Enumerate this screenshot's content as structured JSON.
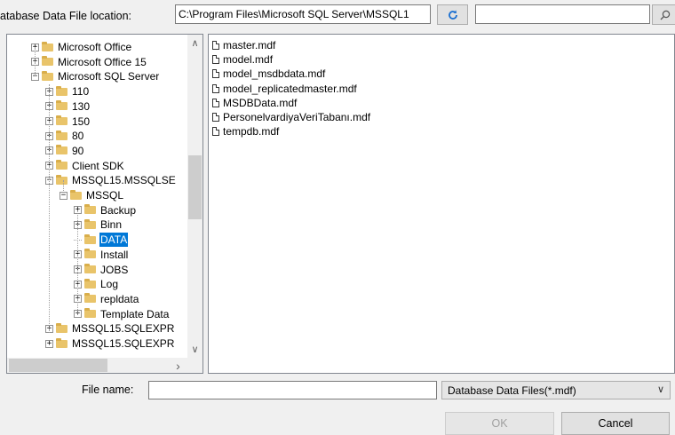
{
  "location": {
    "label": "atabase Data File location:",
    "path": "C:\\Program Files\\Microsoft SQL Server\\MSSQL1"
  },
  "icons": {
    "refresh": "refresh-icon",
    "search": "search-icon",
    "expand": "+",
    "collapse": "−",
    "scroll_up": "∧",
    "scroll_down": "∨",
    "scroll_right": "›"
  },
  "tree": {
    "nodes": [
      {
        "label": "Microsoft Office",
        "state": "collapsed",
        "level": 0
      },
      {
        "label": "Microsoft Office 15",
        "state": "collapsed",
        "level": 0
      },
      {
        "label": "Microsoft SQL Server",
        "state": "expanded",
        "level": 0
      },
      {
        "label": "110",
        "state": "collapsed",
        "level": 1
      },
      {
        "label": "130",
        "state": "collapsed",
        "level": 1
      },
      {
        "label": "150",
        "state": "collapsed",
        "level": 1
      },
      {
        "label": "80",
        "state": "collapsed",
        "level": 1
      },
      {
        "label": "90",
        "state": "collapsed",
        "level": 1
      },
      {
        "label": "Client SDK",
        "state": "collapsed",
        "level": 1
      },
      {
        "label": "MSSQL15.MSSQLSE",
        "state": "expanded",
        "level": 1
      },
      {
        "label": "MSSQL",
        "state": "expanded",
        "level": 2
      },
      {
        "label": "Backup",
        "state": "collapsed",
        "level": 3
      },
      {
        "label": "Binn",
        "state": "collapsed",
        "level": 3
      },
      {
        "label": "DATA",
        "state": "leaf",
        "level": 3,
        "selected": true
      },
      {
        "label": "Install",
        "state": "collapsed",
        "level": 3
      },
      {
        "label": "JOBS",
        "state": "collapsed",
        "level": 3
      },
      {
        "label": "Log",
        "state": "collapsed",
        "level": 3
      },
      {
        "label": "repldata",
        "state": "collapsed",
        "level": 3
      },
      {
        "label": "Template Data",
        "state": "collapsed",
        "level": 3
      },
      {
        "label": "MSSQL15.SQLEXPR",
        "state": "collapsed",
        "level": 1
      },
      {
        "label": "MSSQL15.SQLEXPR",
        "state": "collapsed",
        "level": 1
      }
    ]
  },
  "files": [
    "master.mdf",
    "model.mdf",
    "model_msdbdata.mdf",
    "model_replicatedmaster.mdf",
    "MSDBData.mdf",
    "PersonelvardiyaVeriTabanı.mdf",
    "tempdb.mdf"
  ],
  "file_name": {
    "label": "File name:",
    "value": ""
  },
  "filter": {
    "selected": "Database Data Files(*.mdf)"
  },
  "buttons": {
    "ok": "OK",
    "cancel": "Cancel"
  },
  "colors": {
    "selection": "#0078d7",
    "folder": "#e9c46a"
  }
}
